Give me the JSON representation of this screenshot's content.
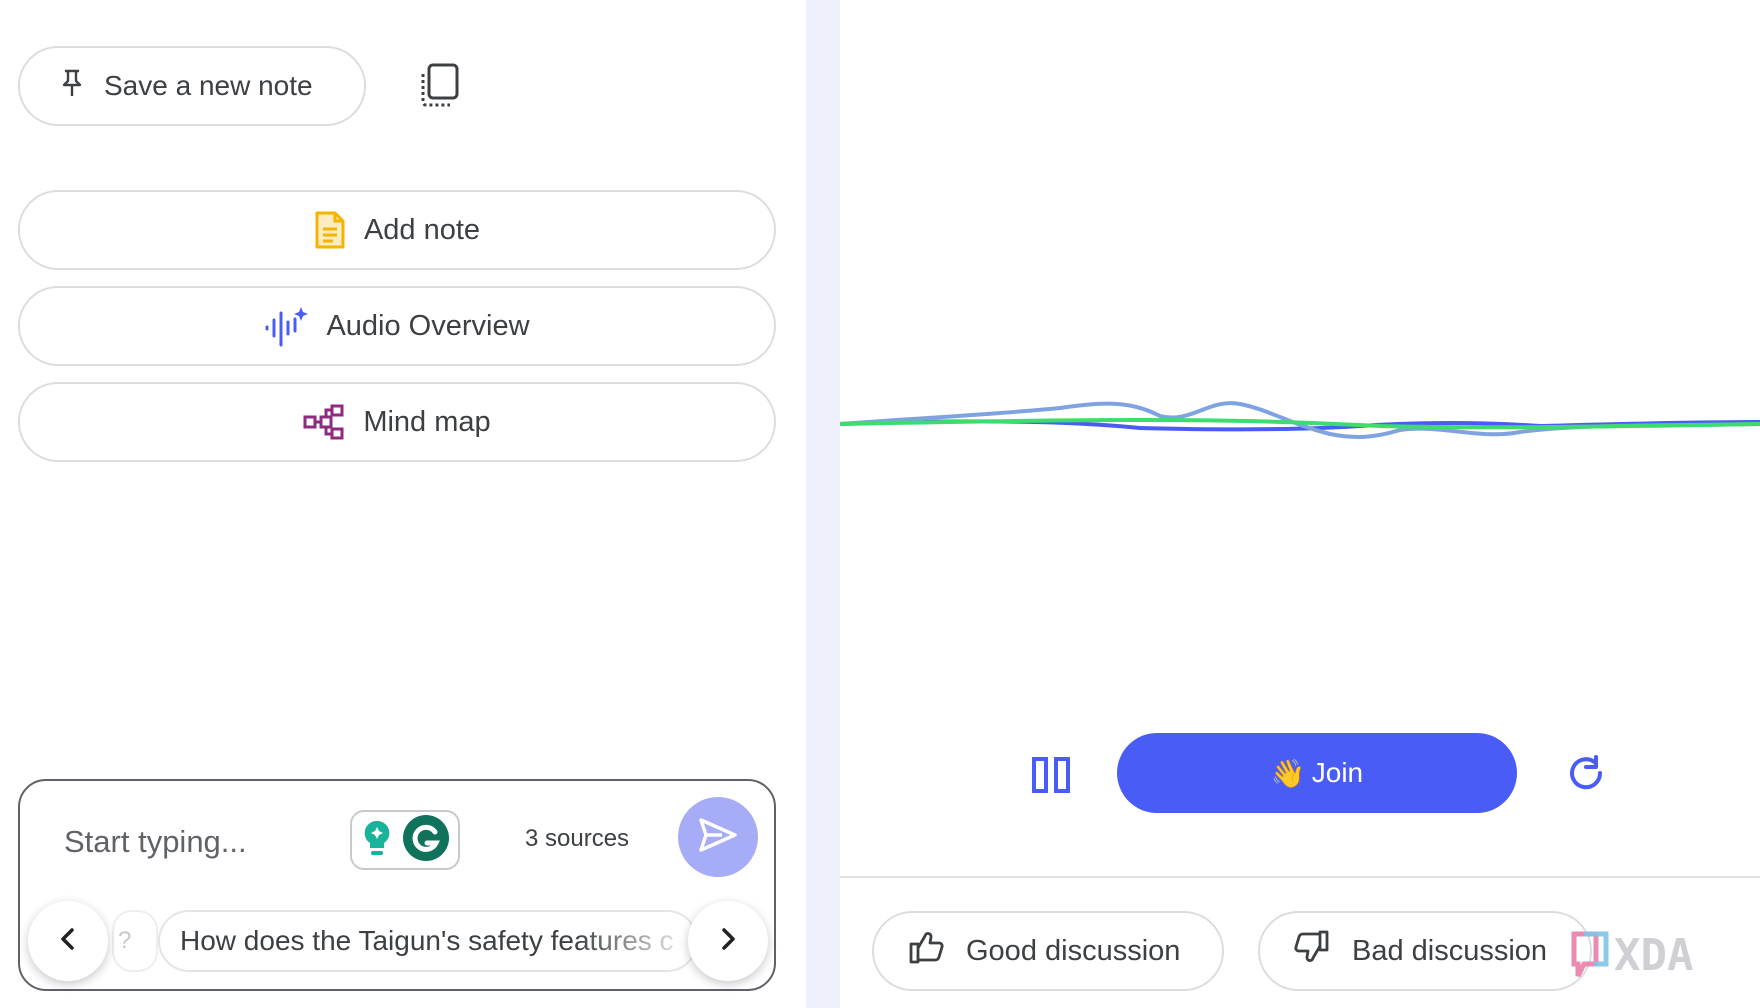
{
  "notes_panel": {
    "save_note_label": "Save a new note",
    "actions": [
      {
        "label": "Add note",
        "icon": "note-icon",
        "color": "#f4b400"
      },
      {
        "label": "Audio Overview",
        "icon": "audio-overview-icon",
        "color": "#4a5cf6"
      },
      {
        "label": "Mind map",
        "icon": "mind-map-icon",
        "color": "#8e2a7f"
      }
    ]
  },
  "chat": {
    "placeholder": "Start typing...",
    "sources": "3 sources",
    "suggestion": "How does the Taigun's safety features c",
    "hidden_chip_text": "?"
  },
  "audio_player": {
    "join_label": "Join",
    "join_emoji": "👋",
    "accent_color": "#4a5cf6",
    "wave_colors": [
      "#4a5cf6",
      "#7fa3e0",
      "#3ddc6e"
    ]
  },
  "feedback": {
    "good_label": "Good discussion",
    "bad_label": "Bad discussion"
  },
  "watermark": "XDA"
}
